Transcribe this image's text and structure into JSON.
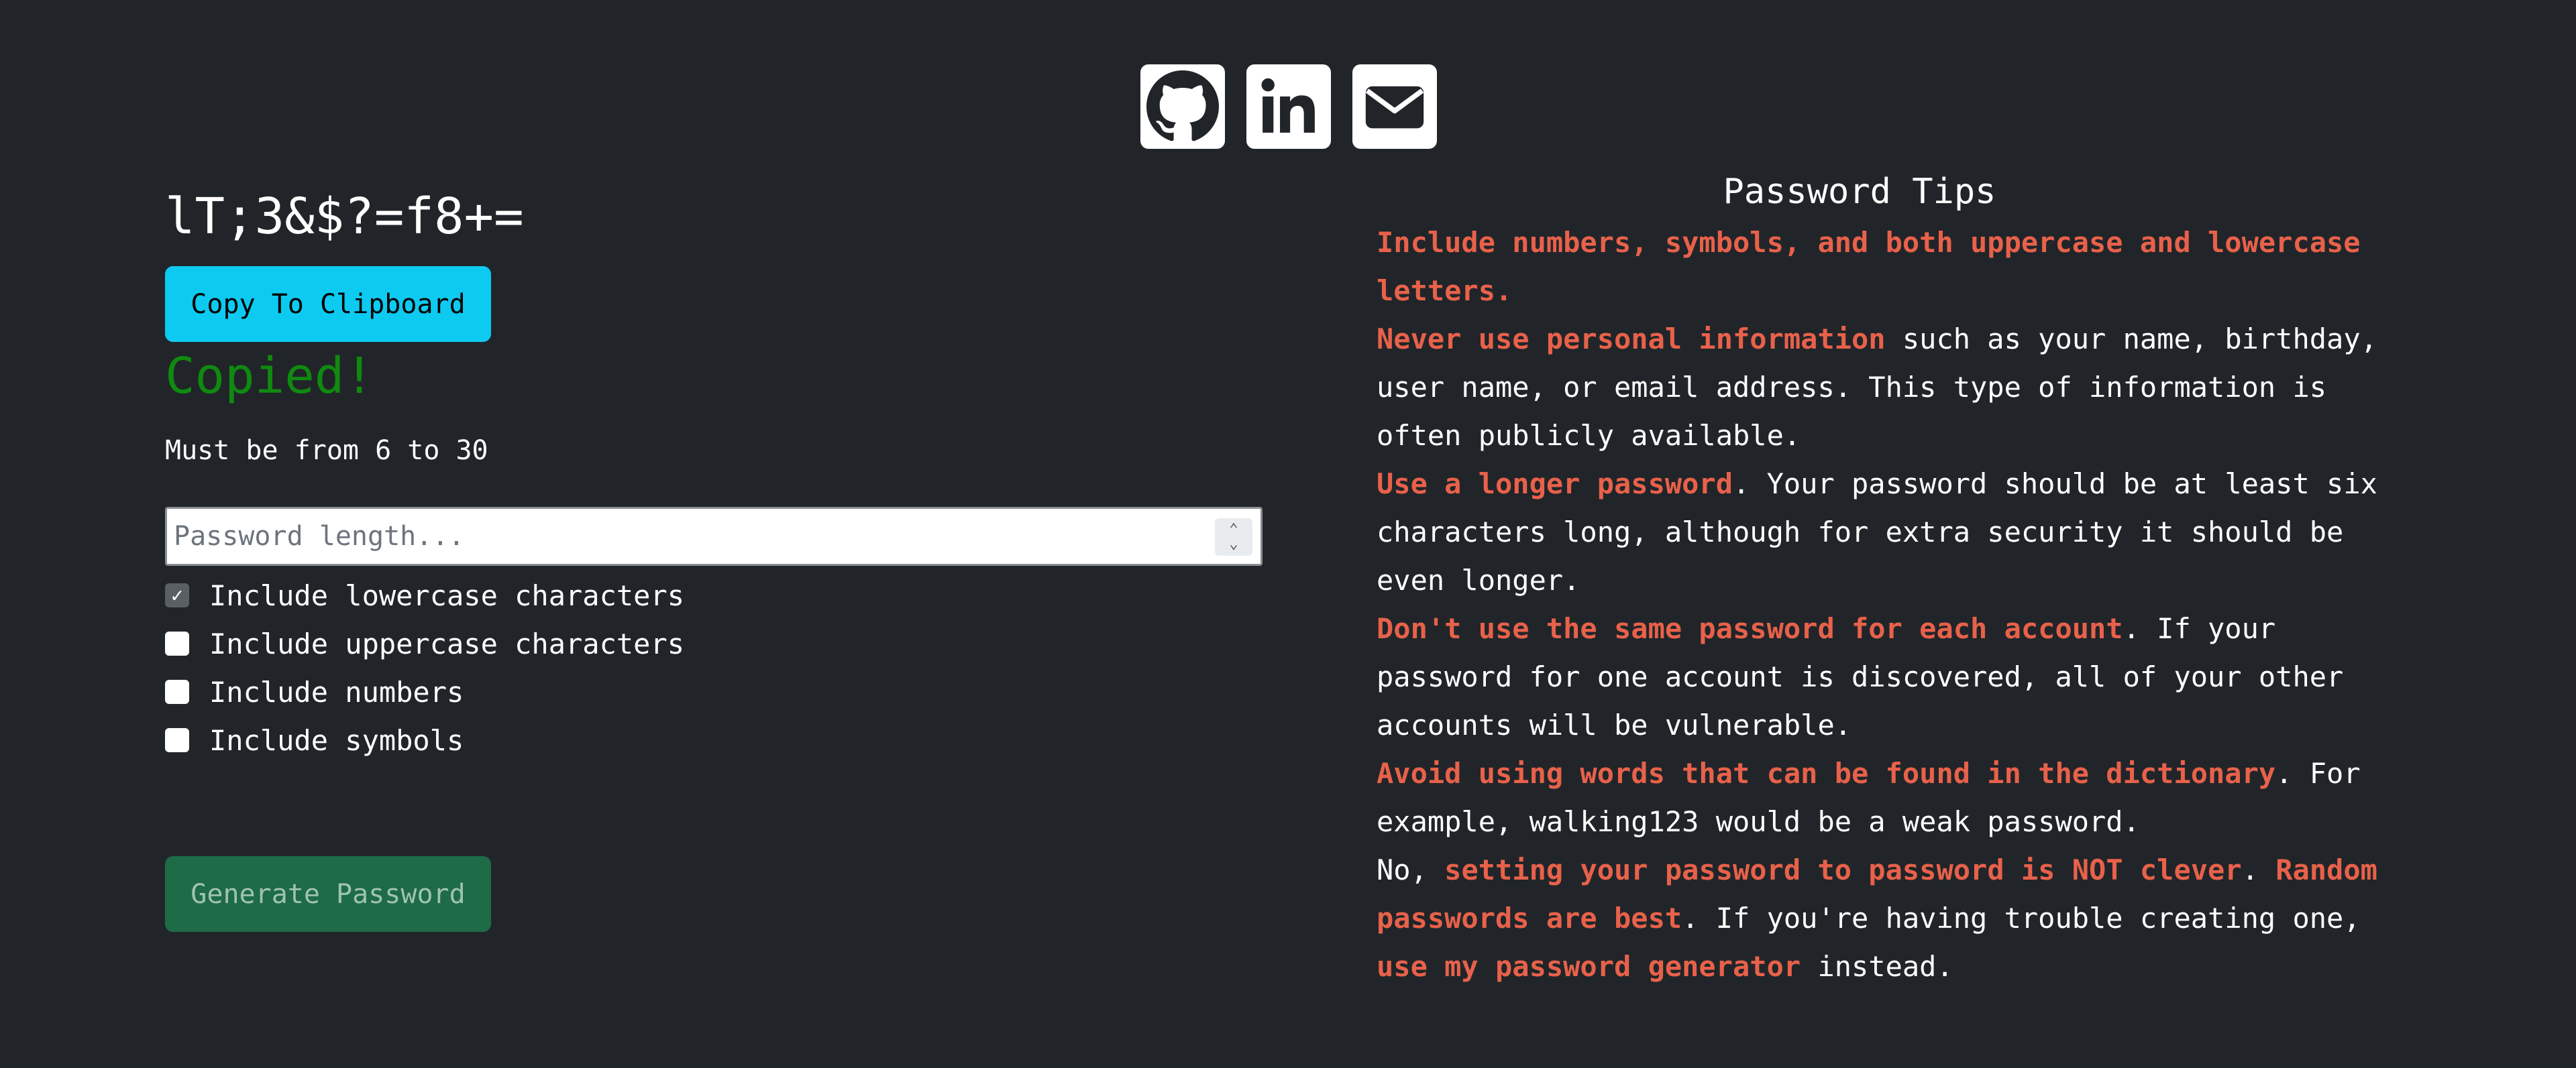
{
  "social": {
    "github_icon": "github-icon",
    "linkedin_icon": "linkedin-icon",
    "email_icon": "envelope-icon"
  },
  "generator": {
    "password": "lT;3&$?=f8+=",
    "copy_label": "Copy To Clipboard",
    "copied_text": "Copied!",
    "hint": "Must be from 6 to 30",
    "length_placeholder": "Password length...",
    "length_value": "",
    "options": [
      {
        "label": "Include lowercase characters",
        "checked": true
      },
      {
        "label": "Include uppercase characters",
        "checked": false
      },
      {
        "label": "Include numbers",
        "checked": false
      },
      {
        "label": "Include symbols",
        "checked": false
      }
    ],
    "generate_label": "Generate Password"
  },
  "tips": {
    "title": "Password Tips",
    "t1_hl": "Include numbers, symbols, and both uppercase and lowercase letters.",
    "t2_hl": "Never use personal information",
    "t2_rest": " such as your name, birthday, user name, or email address. This type of information is often publicly available.",
    "t3_hl": "Use a longer password",
    "t3_rest": ". Your password should be at least six characters long, although for extra security it should be even longer.",
    "t4_hl": "Don't use the same password for each account",
    "t4_rest": ". If your password for one account is discovered, all of your other accounts will be vulnerable.",
    "t5_hl": "Avoid using words that can be found in the dictionary",
    "t5_rest": ". For example, walking123 would be a weak password.",
    "t6_a": "No, ",
    "t6_hl1": "setting your password to password is NOT clever",
    "t6_b": ". ",
    "t6_hl2": "Random passwords are best",
    "t6_c": ". If you're having trouble creating one, ",
    "t6_hl3": "use my password generator",
    "t6_d": " instead."
  },
  "colors": {
    "background": "#212529",
    "copy_button": "#0dcaf0",
    "copied_text": "#0f8a0f",
    "generate_button": "#1d6b47",
    "tip_highlight": "#e8614a"
  }
}
